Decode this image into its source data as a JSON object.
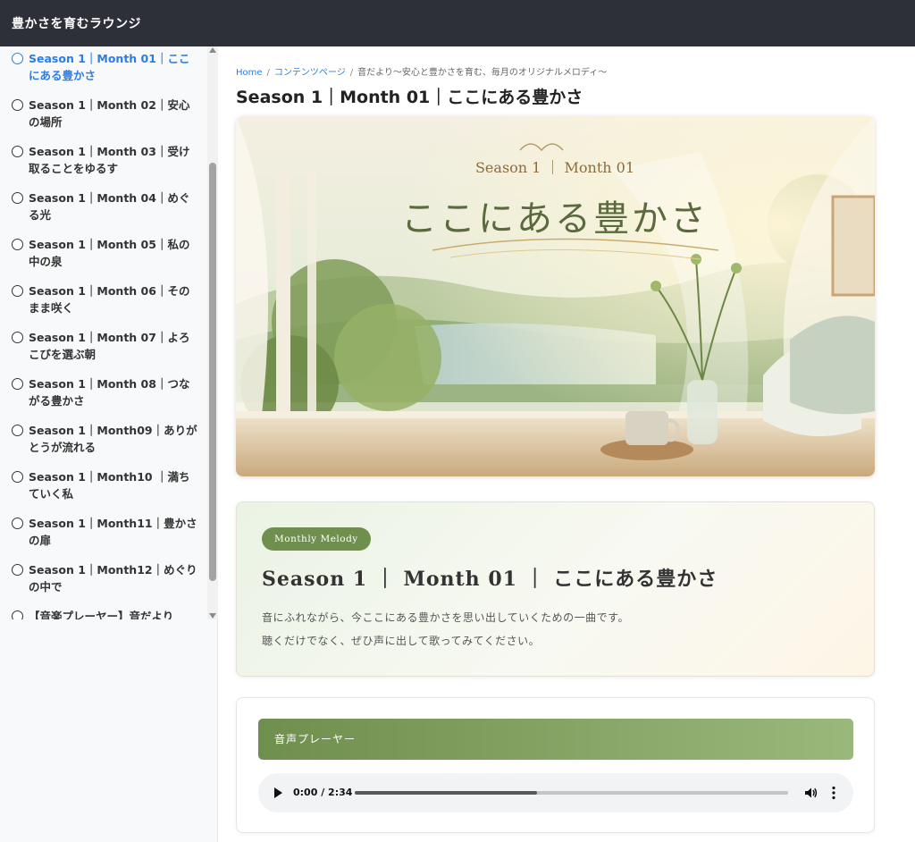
{
  "header": {
    "site_title": "豊かさを育むラウンジ"
  },
  "sidebar": {
    "items": [
      {
        "label": "Season 1｜Month 01｜ここにある豊かさ"
      },
      {
        "label": "Season 1｜Month 02｜安心の場所"
      },
      {
        "label": "Season 1｜Month 03｜受け取ることをゆるす"
      },
      {
        "label": "Season 1｜Month 04｜めぐる光"
      },
      {
        "label": "Season 1｜Month 05｜私の中の泉"
      },
      {
        "label": "Season 1｜Month 06｜そのまま咲く"
      },
      {
        "label": "Season 1｜Month 07｜よろこびを選ぶ朝"
      },
      {
        "label": "Season 1｜Month 08｜つながる豊かさ"
      },
      {
        "label": "Season 1｜Month09｜ありがとうが流れる"
      },
      {
        "label": "Season 1｜Month10 ｜満ちていく私"
      },
      {
        "label": "Season 1｜Month11｜豊かさの扉"
      },
      {
        "label": "Season 1｜Month12｜めぐりの中で"
      },
      {
        "label": "【音楽プレーヤー】音だより"
      }
    ]
  },
  "breadcrumb": {
    "home": "Home",
    "separator": "/",
    "content": "コンテンツページ",
    "current": "音だより〜安心と豊かさを育む、毎月のオリジナルメロディ〜"
  },
  "page": {
    "title": "Season 1｜Month 01｜ここにある豊かさ"
  },
  "hero": {
    "subtitle": "Season 1 ｜ Month 01",
    "title": "ここにある豊かさ"
  },
  "intro": {
    "badge": "Monthly Melody",
    "title": "Season 1 ｜ Month 01 ｜ ここにある豊かさ",
    "line1": "音にふれながら、今ここにある豊かさを思い出していくための一曲です。",
    "line2": "聴くだけでなく、ぜひ声に出して歌ってみてください。"
  },
  "player": {
    "header": "音声プレーヤー",
    "time": "0:00 / 2:34",
    "progress": 0.42
  },
  "colors": {
    "topbar": "#2d3038",
    "active_link": "#2b7de9",
    "accent_green": "#6f8f4e"
  },
  "icons": [
    "circle-icon",
    "play-icon",
    "volume-icon",
    "more-vert-icon",
    "scroll-up-arrow-icon",
    "scroll-down-arrow-icon"
  ]
}
